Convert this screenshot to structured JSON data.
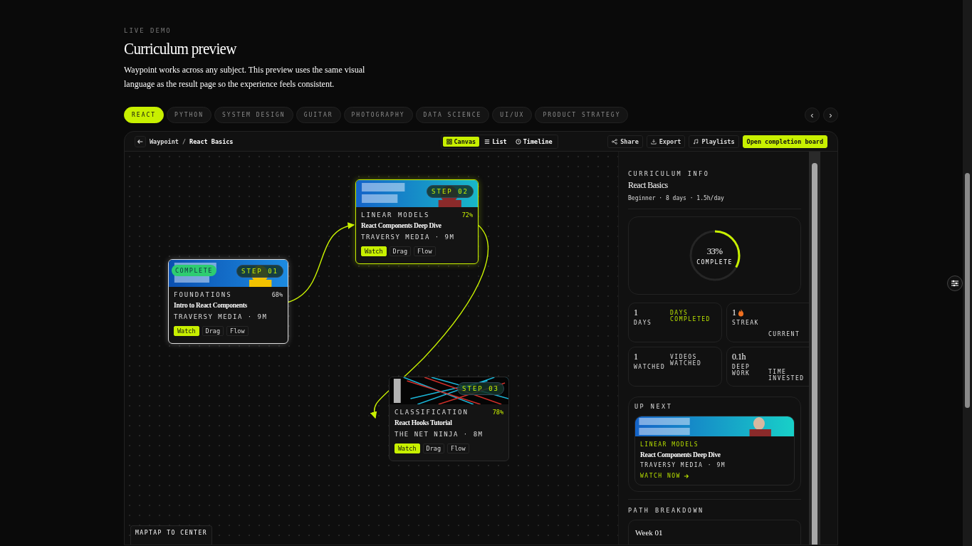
{
  "header": {
    "eyebrow": "LIVE DEMO",
    "title": "Curriculum preview",
    "description": "Waypoint works across any subject. This preview uses the same visual language as the result page so the experience feels consistent."
  },
  "subject_tabs": [
    {
      "label": "REACT",
      "selected": true
    },
    {
      "label": "PYTHON",
      "selected": false
    },
    {
      "label": "SYSTEM DESIGN",
      "selected": false
    },
    {
      "label": "GUITAR",
      "selected": false
    },
    {
      "label": "PHOTOGRAPHY",
      "selected": false
    },
    {
      "label": "DATA SCIENCE",
      "selected": false
    },
    {
      "label": "UI/UX",
      "selected": false
    },
    {
      "label": "PRODUCT STRATEGY",
      "selected": false
    }
  ],
  "carousel": {
    "prev": "‹",
    "next": "›"
  },
  "toolbar": {
    "breadcrumb_root": "Waypoint",
    "separator": "/",
    "breadcrumb_current": "React Basics",
    "views": [
      {
        "label": "Canvas",
        "kind": "grid",
        "selected": true
      },
      {
        "label": "List",
        "kind": "list",
        "selected": false
      },
      {
        "label": "Timeline",
        "kind": "clock",
        "selected": false
      }
    ],
    "actions": [
      {
        "label": "Share",
        "kind": "share",
        "primary": false
      },
      {
        "label": "Export",
        "kind": "download",
        "primary": false
      },
      {
        "label": "Playlists",
        "kind": "music",
        "primary": false
      },
      {
        "label": "Open completion board",
        "kind": "none",
        "primary": true
      }
    ]
  },
  "nodes": [
    {
      "step": "STEP 01",
      "complete": true,
      "complete_label": "COMPLETE",
      "selected": false,
      "topic": "FOUNDATIONS",
      "percent": "68%",
      "title": "Intro to React Components",
      "meta": "TRAVERSY MEDIA · 9M",
      "actions": [
        {
          "label": "Watch",
          "selected": true
        },
        {
          "label": "Drag",
          "selected": false
        },
        {
          "label": "Flow",
          "selected": false
        }
      ]
    },
    {
      "step": "STEP 02",
      "complete": false,
      "selected": true,
      "topic": "LINEAR MODELS",
      "percent": "72%",
      "title": "React Components Deep Dive",
      "meta": "TRAVERSY MEDIA · 9M",
      "actions": [
        {
          "label": "Watch",
          "selected": true
        },
        {
          "label": "Drag",
          "selected": false
        },
        {
          "label": "Flow",
          "selected": false
        }
      ]
    },
    {
      "step": "STEP 03",
      "complete": false,
      "selected": false,
      "topic": "CLASSIFICATION",
      "percent": "78%",
      "title": "React Hooks Tutorial",
      "meta": "THE NET NINJA · 8M",
      "actions": [
        {
          "label": "Watch",
          "selected": true
        },
        {
          "label": "Drag",
          "selected": false
        },
        {
          "label": "Flow",
          "selected": false
        }
      ]
    }
  ],
  "minimap_label": "MAPTAP TO CENTER",
  "info": {
    "heading": "CURRICULUM INFO",
    "name": "React Basics",
    "details": "Beginner · 8 days · 1.5h/day",
    "progress": {
      "level": 0.33,
      "value": "33%",
      "label": "COMPLETE"
    },
    "stats": [
      {
        "value": "1",
        "label": "DAYS",
        "side": "DAYS COMPLETED",
        "accent": true,
        "flame": false
      },
      {
        "value": "1",
        "label": "STREAK",
        "side": "CURRENT",
        "accent": false,
        "flame": true
      },
      {
        "value": "1",
        "label": "WATCHED",
        "side": "VIDEOS WATCHED",
        "accent": false,
        "flame": false
      },
      {
        "value": "0.1h",
        "label": "DEEP WORK",
        "side": "TIME INVESTED",
        "accent": false,
        "flame": false
      }
    ],
    "up_next": {
      "heading": "UP NEXT",
      "topic": "LINEAR MODELS",
      "title": "React Components Deep Dive",
      "meta": "TRAVERSY MEDIA · 9M",
      "link": "WATCH NOW"
    },
    "breakdown": {
      "heading": "PATH BREAKDOWN",
      "first_week": "Week 01"
    }
  }
}
